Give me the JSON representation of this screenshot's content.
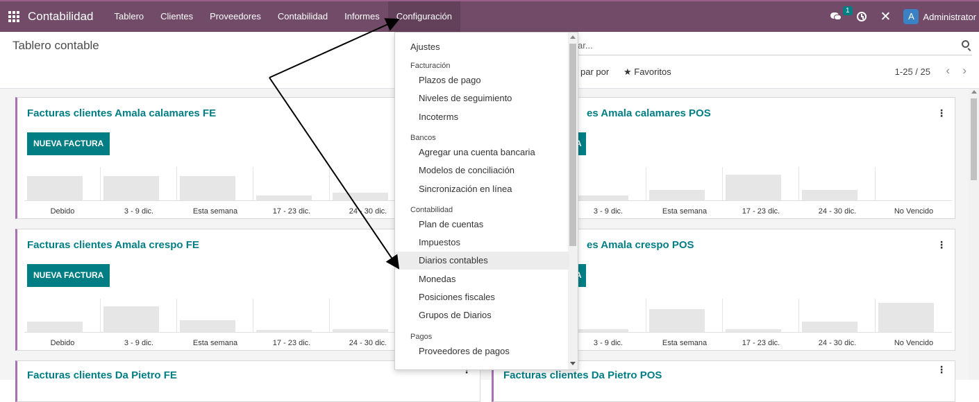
{
  "navbar": {
    "brand": "Contabilidad",
    "items": [
      "Tablero",
      "Clientes",
      "Proveedores",
      "Contabilidad",
      "Informes",
      "Configuración"
    ],
    "chat_badge": "1",
    "user_initial": "A",
    "user_name": "Administrator",
    "color": "#714b67"
  },
  "control_panel": {
    "title": "Tablero contable",
    "search_placeholder": "ar...",
    "groupby_label": "par por",
    "favorites_label": "★ Favoritos",
    "pager": "1-25 / 25"
  },
  "dropdown": {
    "top_item": "Ajustes",
    "sections": [
      {
        "header": "Facturación",
        "items": [
          "Plazos de pago",
          "Niveles de seguimiento",
          "Incoterms"
        ]
      },
      {
        "header": "Bancos",
        "items": [
          "Agregar una cuenta bancaria",
          "Modelos de conciliación",
          "Sincronización en línea"
        ]
      },
      {
        "header": "Contabilidad",
        "items": [
          "Plan de cuentas",
          "Impuestos",
          "Diarios contables",
          "Monedas",
          "Posiciones fiscales",
          "Grupos de Diarios"
        ]
      },
      {
        "header": "Pagos",
        "items": [
          "Proveedores de pagos"
        ]
      }
    ],
    "highlighted": "Diarios contables"
  },
  "cards": [
    {
      "title": "Facturas clientes Amala calamares FE",
      "button": "NUEVA FACTURA",
      "labels": [
        "Debido",
        "3 - 9 dic.",
        "Esta semana",
        "17 - 23 dic.",
        "24 - 30 dic."
      ],
      "bars": [
        0.8,
        0.8,
        0.8,
        0.15,
        0.25
      ]
    },
    {
      "title": "es Amala calamares POS",
      "button": "A",
      "labels": [
        "3 - 9 dic.",
        "Esta semana",
        "17 - 23 dic.",
        "24 - 30 dic.",
        "No Vencido"
      ],
      "bars": [
        0.15,
        0.33,
        0.85,
        0.33,
        0
      ]
    },
    {
      "title": "Facturas clientes Amala crespo FE",
      "button": "NUEVA FACTURA",
      "labels": [
        "Debido",
        "3 - 9 dic.",
        "Esta semana",
        "17 - 23 dic.",
        "24 - 30 dic."
      ],
      "bars": [
        0.33,
        0.85,
        0.38,
        0.06,
        0.1
      ]
    },
    {
      "title": "es Amala crespo POS",
      "button": "A",
      "labels": [
        "3 - 9 dic.",
        "Esta semana",
        "17 - 23 dic.",
        "24 - 30 dic.",
        "No Vencido"
      ],
      "bars": [
        0.1,
        0.75,
        0.1,
        0.33,
        0.95
      ]
    },
    {
      "title": "Facturas clientes Da Pietro FE"
    },
    {
      "title": "Facturas clientes Da Pietro POS"
    }
  ],
  "annotation_colors": {
    "arrow": "#000000"
  }
}
